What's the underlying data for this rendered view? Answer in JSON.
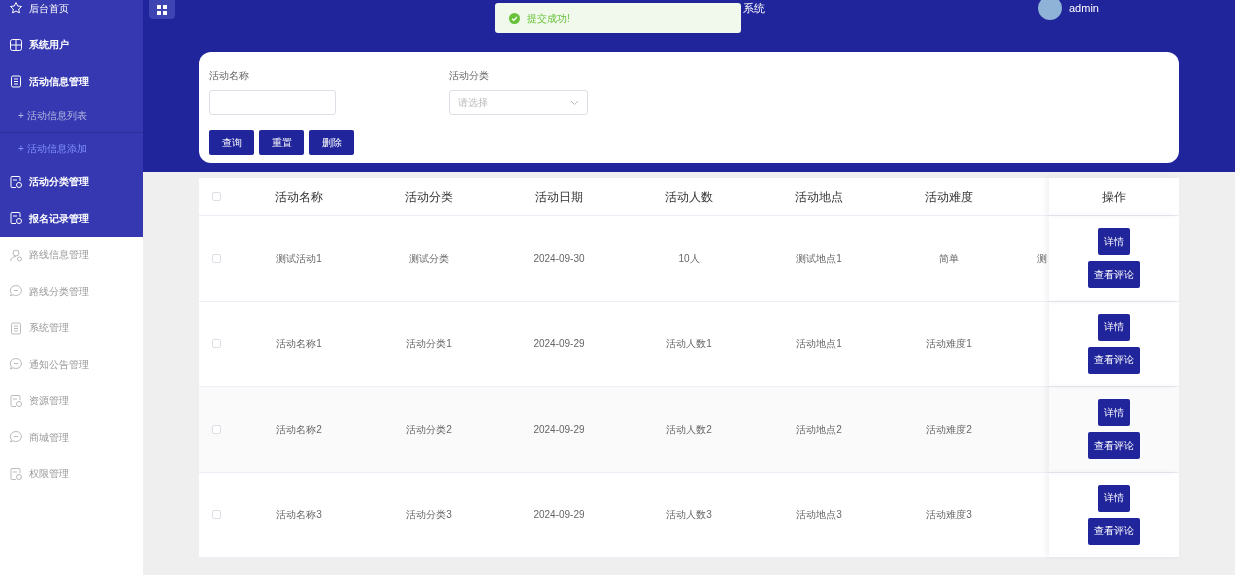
{
  "sidebar": {
    "items": [
      {
        "label": "后台首页",
        "highlighted": true,
        "bold": false
      },
      {
        "label": "系统用户",
        "highlighted": true,
        "bold": true
      },
      {
        "label": "活动信息管理",
        "highlighted": true,
        "bold": true,
        "children": [
          {
            "label": "+ 活动信息列表",
            "selected": false
          },
          {
            "label": "+ 活动信息添加",
            "selected": true
          }
        ]
      },
      {
        "label": "活动分类管理",
        "highlighted": true,
        "bold": true
      },
      {
        "label": "报名记录管理",
        "highlighted": true,
        "bold": true
      },
      {
        "label": "路线信息管理",
        "highlighted": false,
        "bold": false
      },
      {
        "label": "路线分类管理",
        "highlighted": false,
        "bold": false
      },
      {
        "label": "系统管理",
        "highlighted": false,
        "bold": false
      },
      {
        "label": "通知公告管理",
        "highlighted": false,
        "bold": false
      },
      {
        "label": "资源管理",
        "highlighted": false,
        "bold": false
      },
      {
        "label": "商城管理",
        "highlighted": false,
        "bold": false
      },
      {
        "label": "权限管理",
        "highlighted": false,
        "bold": false
      }
    ]
  },
  "header": {
    "title": "系统",
    "user": "admin"
  },
  "toast": {
    "message": "提交成功!"
  },
  "search": {
    "fields": [
      {
        "label": "活动名称",
        "kind": "input"
      },
      {
        "label": "活动分类",
        "kind": "select",
        "placeholder": "请选择"
      }
    ],
    "buttons": [
      "查询",
      "重置",
      "删除"
    ]
  },
  "table": {
    "columns": [
      "活动名称",
      "活动分类",
      "活动日期",
      "活动人数",
      "活动地点",
      "活动难度"
    ],
    "action_column": "操作",
    "all_checked": false,
    "rows": [
      {
        "checked": false,
        "cells": [
          "测试活动1",
          "测试分类",
          "2024-09-30",
          "10人",
          "测试地点1",
          "简单"
        ],
        "column_7": "测",
        "actions": [
          "详情",
          "查看评论"
        ]
      },
      {
        "checked": false,
        "cells": [
          "活动名称1",
          "活动分类1",
          "2024-09-29",
          "活动人数1",
          "活动地点1",
          "活动难度1"
        ],
        "actions": [
          "详情",
          "查看评论"
        ]
      },
      {
        "checked": false,
        "cells": [
          "活动名称2",
          "活动分类2",
          "2024-09-29",
          "活动人数2",
          "活动地点2",
          "活动难度2"
        ],
        "actions": [
          "详情",
          "查看评论"
        ]
      },
      {
        "checked": false,
        "cells": [
          "活动名称3",
          "活动分类3",
          "2024-09-29",
          "活动人数3",
          "活动地点3",
          "活动难度3"
        ],
        "actions": [
          "详情",
          "查看评论"
        ]
      }
    ]
  }
}
